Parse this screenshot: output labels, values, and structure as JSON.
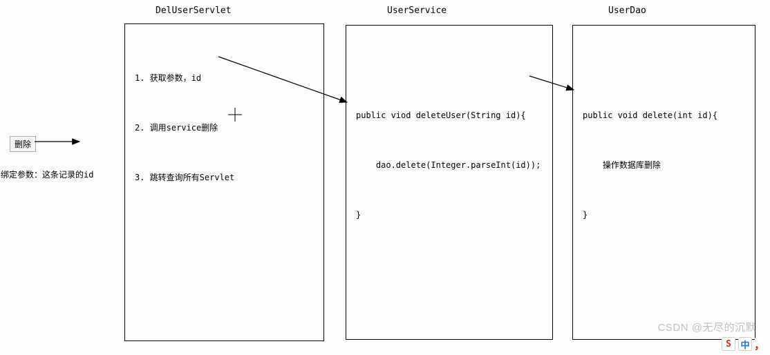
{
  "titles": {
    "servlet": "DelUserServlet",
    "service": "UserService",
    "dao": "UserDao"
  },
  "servlet": {
    "line1": "1. 获取参数，id",
    "line2": "2. 调用service删除",
    "line3": "3. 跳转查询所有Servlet"
  },
  "service": {
    "line1": "public viod deleteUser(String id){",
    "line2": "    dao.delete(Integer.parseInt(id));",
    "line3": "}"
  },
  "dao": {
    "line1": "public void delete(int id){",
    "line2": "    操作数据库删除",
    "line3": "}"
  },
  "sidebar": {
    "button": "删除",
    "note": "绑定参数：这条记录的id"
  },
  "watermark": "CSDN @无尽的沉默",
  "ime": {
    "icon1_label": "S",
    "icon2_label": "中",
    "icon3_label": "，"
  }
}
